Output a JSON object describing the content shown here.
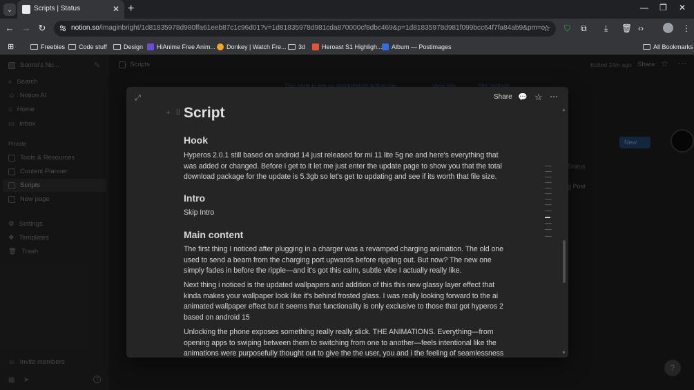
{
  "browser": {
    "tab_title": "Scripts | Status",
    "url_host": "notion.so",
    "url_path": "/imaginbright/1d81835978d980ffa61eeb87c1c96d01?v=1d81835978d981cda870000cf8dbc469&p=1d81835978d981f099bcc64f7fa84ab9&pm=c",
    "bookmarks": [
      {
        "label": "Freebies",
        "kind": "folder"
      },
      {
        "label": "Code stuff",
        "kind": "folder"
      },
      {
        "label": "Design",
        "kind": "folder"
      },
      {
        "label": "HiAnime Free Anim...",
        "kind": "site",
        "color": "#6a4bdc"
      },
      {
        "label": "Donkey | Watch Fre...",
        "kind": "site",
        "color": "#f5a623"
      },
      {
        "label": "3d",
        "kind": "folder"
      },
      {
        "label": "Heroast S1 Highligh...",
        "kind": "site",
        "color": "#e5533d"
      },
      {
        "label": "Album — Postimages",
        "kind": "site",
        "color": "#2f6fde"
      }
    ],
    "all_bookmarks": "All Bookmarks"
  },
  "notion": {
    "workspace": "Somto's No...",
    "breadcrumb": "Scripts",
    "sidebar_top": [
      "Search",
      "Notion AI",
      "Home",
      "Inbox"
    ],
    "private_label": "Private",
    "private_items": [
      "Tools & Resources",
      "Content Planner",
      "Scripts",
      "New page"
    ],
    "bottom_items": [
      "Settings",
      "Templates",
      "Trash"
    ],
    "invite": "Invite members",
    "edited": "Edited 24m ago",
    "share": "Share",
    "banner": "This page is live on imaginbright.notion.site",
    "view_site": "View site",
    "site_settings": "Site settings",
    "new_button": "New",
    "status_header": "Status",
    "status_value": "g Post"
  },
  "modal": {
    "share": "Share",
    "title": "Script",
    "hook_heading": "Hook",
    "hook_text": "Hyperos 2.0.1 still based on android 14 just released for mi 11 lite 5g ne and here's everything that was added or changed.  Before i get to it let me just enter the update page to show you that the total download package for the update is 5.3gb so let's get to updating and see if its worth that file size.",
    "intro_heading": "Intro",
    "intro_text": "Skip Intro",
    "main_heading": "Main content",
    "para1": "The first thing I noticed after plugging in a charger was a revamped charging animation. The old one used to send a beam from the charging port upwards before rippling out. But now? The new one simply fades in before the ripple—and it's got this calm, subtle vibe I actually really like.",
    "para2": "Next thing i noticed  is the updated wallpapers and addition of this this new glassy layer effect that kinda makes your wallpaper look like it's behind frosted glass. I was really looking forward to the ai animated wallpaper effect but it seems that functionality is only exclusive to those that got hyperos 2 based on android 15",
    "para3": "Unlocking the phone exposes something really really slick. THE ANIMATIONS.  Everything—from opening apps to swiping between them to switching from one to another—feels intentional like the animations were purposefully thought out to give the the user, you and i the feeling of seamlessness"
  }
}
